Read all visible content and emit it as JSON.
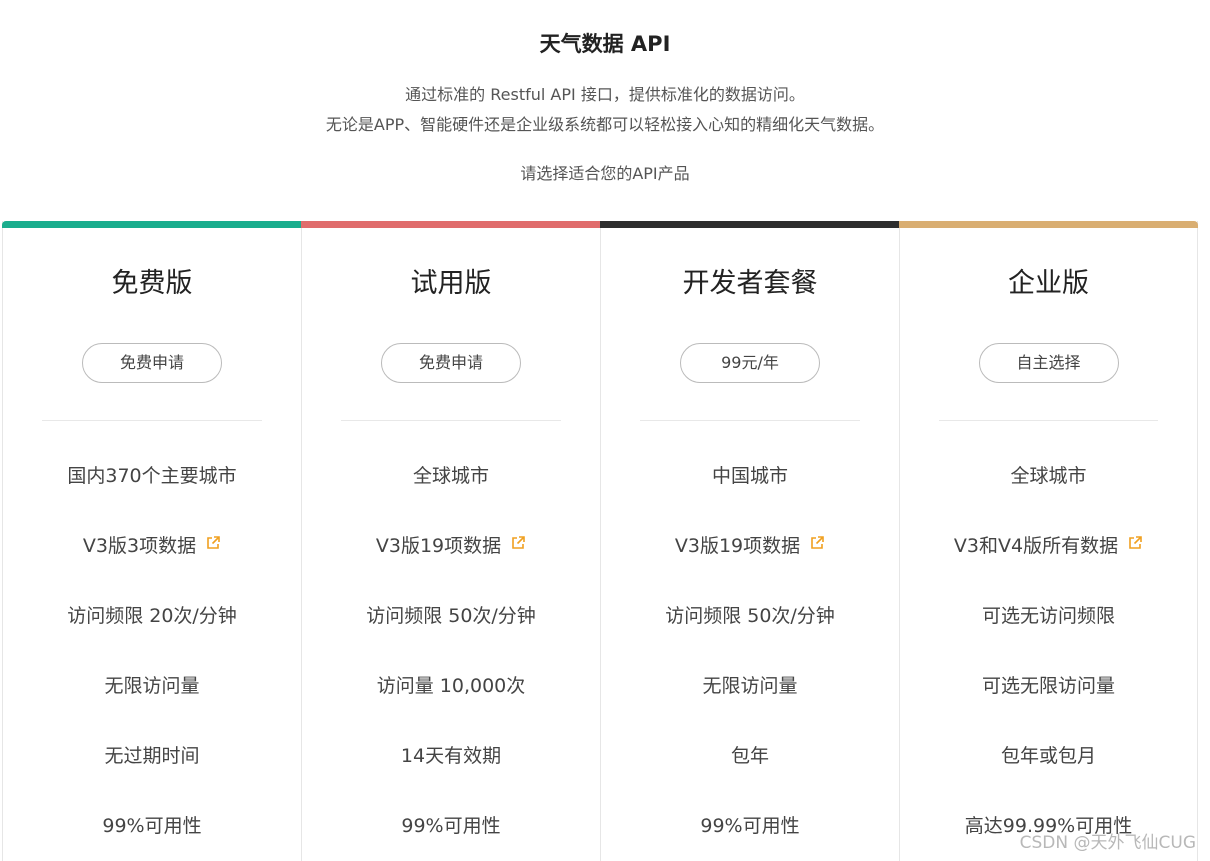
{
  "header": {
    "title": "天气数据 API",
    "intro_line1": "通过标准的 Restful API 接口，提供标准化的数据访问。",
    "intro_line2": "无论是APP、智能硬件还是企业级系统都可以轻松接入心知的精细化天气数据。",
    "choose_text": "请选择适合您的API产品"
  },
  "plans": [
    {
      "name": "免费版",
      "button": "免费申请",
      "accent": "#1aad8d",
      "features": [
        "国内370个主要城市",
        "V3版3项数据",
        "访问频限 20次/分钟",
        "无限访问量",
        "无过期时间",
        "99%可用性"
      ]
    },
    {
      "name": "试用版",
      "button": "免费申请",
      "accent": "#e06c6c",
      "features": [
        "全球城市",
        "V3版19项数据",
        "访问频限 50次/分钟",
        "访问量 10,000次",
        "14天有效期",
        "99%可用性"
      ]
    },
    {
      "name": "开发者套餐",
      "button": "99元/年",
      "accent": "#2d2d2d",
      "features": [
        "中国城市",
        "V3版19项数据",
        "访问频限 50次/分钟",
        "无限访问量",
        "包年",
        "99%可用性"
      ]
    },
    {
      "name": "企业版",
      "button": "自主选择",
      "accent": "#d9ae72",
      "features": [
        "全球城市",
        "V3和V4版所有数据",
        "可选无访问频限",
        "可选无限访问量",
        "包年或包月",
        "高达99.99%可用性"
      ]
    }
  ],
  "icons": {
    "external_link": "external-link-icon",
    "external_link_color": "#f0a020"
  },
  "watermark": "CSDN @天外飞仙CUG"
}
